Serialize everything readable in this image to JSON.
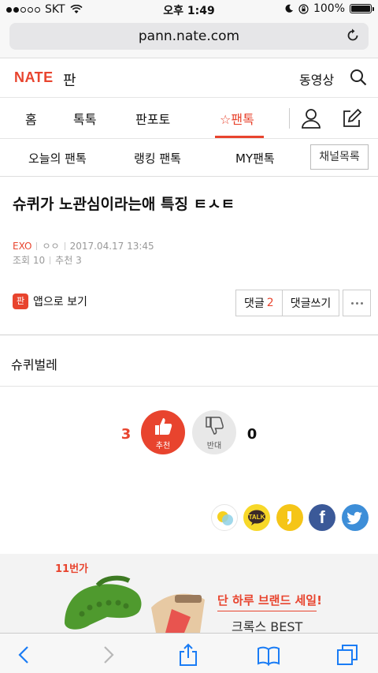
{
  "status_bar": {
    "carrier": "SKT",
    "time": "오후 1:49",
    "battery": "100%"
  },
  "browser": {
    "url": "pann.nate.com"
  },
  "header": {
    "logo": "NATE",
    "section": "판",
    "video_label": "동영상"
  },
  "nav": {
    "tabs": [
      {
        "label": "홈"
      },
      {
        "label": "톡톡"
      },
      {
        "label": "판포토"
      },
      {
        "label": "☆팬톡",
        "active": true
      }
    ]
  },
  "subnav": {
    "items": [
      "오늘의 팬톡",
      "랭킹 팬톡",
      "MY팬톡"
    ],
    "channel_list": "채널목록"
  },
  "article": {
    "title": "슈퀴가 노관심이라는애 특징 ㅌㅅㅌ",
    "category": "EXO",
    "author": "ㅇㅇ",
    "date": "2017.04.17 13:45",
    "views_label": "조회 10",
    "recommend_label": "추천 3",
    "app_view": "앱으로 보기",
    "app_icon": "판",
    "comment_label": "댓글",
    "comment_count": "2",
    "write_comment": "댓글쓰기",
    "body": "슈퀴벌레"
  },
  "votes": {
    "up_count": "3",
    "up_label": "추천",
    "down_count": "0",
    "down_label": "반대"
  },
  "ad": {
    "brand": "11번가",
    "headline": "단 하루 브랜드 세일!",
    "subline": "크록스 BEST"
  },
  "colors": {
    "accent": "#e8442e",
    "facebook": "#3b5998",
    "twitter": "#3d8ed8",
    "kakao": "#f7d829",
    "ios_blue": "#1a7cf5"
  }
}
